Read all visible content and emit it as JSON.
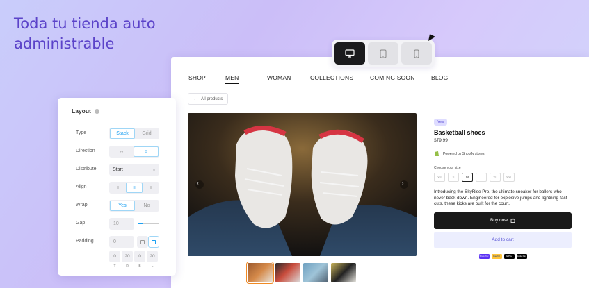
{
  "hero": {
    "title": "Toda tu tienda auto administrable"
  },
  "device_switcher": {
    "devices": [
      {
        "name": "desktop",
        "active": true
      },
      {
        "name": "tablet",
        "active": false
      },
      {
        "name": "mobile",
        "active": false
      }
    ]
  },
  "store": {
    "nav": [
      "SHOP",
      "MEN",
      "WOMAN",
      "COLLECTIONS",
      "COMING SOON",
      "BLOG"
    ],
    "active_nav": "MEN",
    "back_label": "All products",
    "product": {
      "badge": "New",
      "title": "Basketball shoes",
      "price": "$79.99",
      "powered_by": "Powered by Shopify stores",
      "size_label": "Choose your size",
      "sizes": [
        "XS",
        "S",
        "M",
        "L",
        "XL",
        "XXL"
      ],
      "selected_size": "M",
      "description": "Introducing the SkyRise Pro, the ultimate sneaker for ballers who never back down. Engineered for explosive jumps and lightning-fast cuts, these kicks are built for the court.",
      "buy_label": "Buy now",
      "cart_label": "Add to cart",
      "pay_methods": [
        "Shop Pay",
        "PayPal",
        "G Pay",
        "Apple Pay"
      ]
    },
    "colors": {
      "accent": "#5a55d6",
      "badge_bg": "#dedcff",
      "buy_bg": "#1a1a1a"
    }
  },
  "layout_panel": {
    "title": "Layout",
    "type": {
      "label": "Type",
      "options": [
        "Stack",
        "Grid"
      ],
      "selected": "Stack"
    },
    "direction": {
      "label": "Direction",
      "selected": "vertical"
    },
    "distribute": {
      "label": "Distribute",
      "value": "Start"
    },
    "align": {
      "label": "Align",
      "selected": "center"
    },
    "wrap": {
      "label": "Wrap",
      "options": [
        "Yes",
        "No"
      ],
      "selected": "Yes"
    },
    "gap": {
      "label": "Gap",
      "value": "10"
    },
    "padding": {
      "label": "Padding",
      "value": "0",
      "sides": [
        "0",
        "20",
        "0",
        "20"
      ],
      "side_labels": [
        "T",
        "R",
        "B",
        "L"
      ]
    }
  }
}
